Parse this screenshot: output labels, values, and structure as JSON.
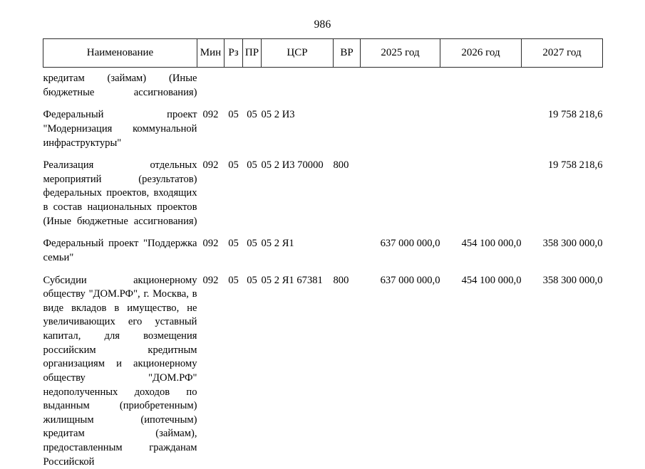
{
  "document": {
    "page_number": "986"
  },
  "table": {
    "headers": [
      "Наименование",
      "Мин",
      "Рз",
      "ПР",
      "ЦСР",
      "ВР",
      "2025 год",
      "2026 год",
      "2027 год"
    ],
    "rows": [
      {
        "name": "кредитам (займам) (Иные бюджетные ассигнования)",
        "min": "",
        "rz": "",
        "pr": "",
        "csr": "",
        "vr": "",
        "y2025": "",
        "y2026": "",
        "y2027": ""
      },
      {
        "name": "Федеральный проект \"Модернизация коммунальной инфраструктуры\"",
        "min": "092",
        "rz": "05",
        "pr": "05",
        "csr": "05 2 И3",
        "vr": "",
        "y2025": "",
        "y2026": "",
        "y2027": "19 758 218,6"
      },
      {
        "name": "Реализация отдельных мероприятий (результатов) федеральных проектов, входящих в состав национальных проектов (Иные бюджетные ассигнования)",
        "min": "092",
        "rz": "05",
        "pr": "05",
        "csr": "05 2 И3 70000",
        "vr": "800",
        "y2025": "",
        "y2026": "",
        "y2027": "19 758 218,6"
      },
      {
        "name": "Федеральный проект \"Поддержка семьи\"",
        "min": "092",
        "rz": "05",
        "pr": "05",
        "csr": "05 2 Я1",
        "vr": "",
        "y2025": "637 000 000,0",
        "y2026": "454 100 000,0",
        "y2027": "358 300 000,0"
      },
      {
        "name": "Субсидии акционерному обществу \"ДОМ.РФ\", г. Москва, в виде вкладов в имущество, не увеличивающих его уставный капитал, для возмещения российским кредитным организациям и акционерному обществу \"ДОМ.РФ\" недополученных доходов по выданным (приобретенным) жилищным (ипотечным) кредитам (займам), предоставленным гражданам Российской",
        "min": "092",
        "rz": "05",
        "pr": "05",
        "csr": "05 2 Я1 67381",
        "vr": "800",
        "y2025": "637 000 000,0",
        "y2026": "454 100 000,0",
        "y2027": "358 300 000,0"
      }
    ]
  }
}
